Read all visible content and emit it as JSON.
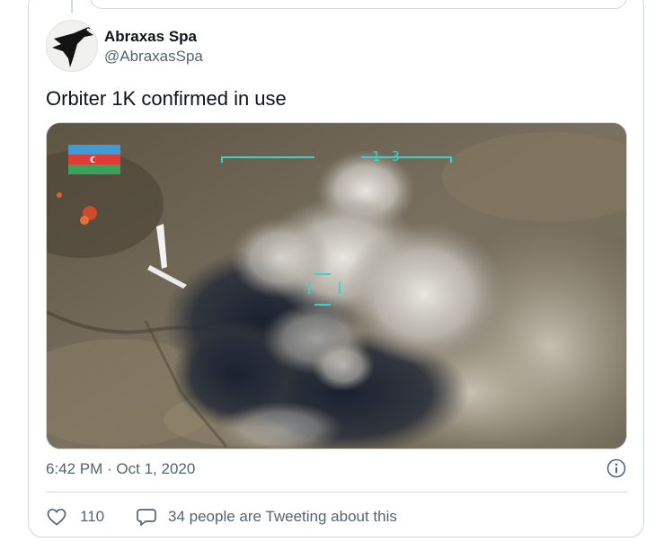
{
  "author": {
    "name": "Abraxas Spa",
    "handle": "@AbraxasSpa"
  },
  "tweet": {
    "text": "Orbiter 1K confirmed in use",
    "timestamp": "6:42 PM · Oct 1, 2020"
  },
  "media": {
    "hud_number": "1 3",
    "icons": [
      "azerbaijan-flag-icon",
      "drone-icon",
      "targeting-reticle-icon"
    ]
  },
  "actions": {
    "like_count": "110",
    "tweeting_text": "34 people are Tweeting about this"
  },
  "colors": {
    "text_primary": "#0f1419",
    "text_secondary": "#536471",
    "border": "#cfd9de",
    "hud": "#3fd0c8"
  }
}
